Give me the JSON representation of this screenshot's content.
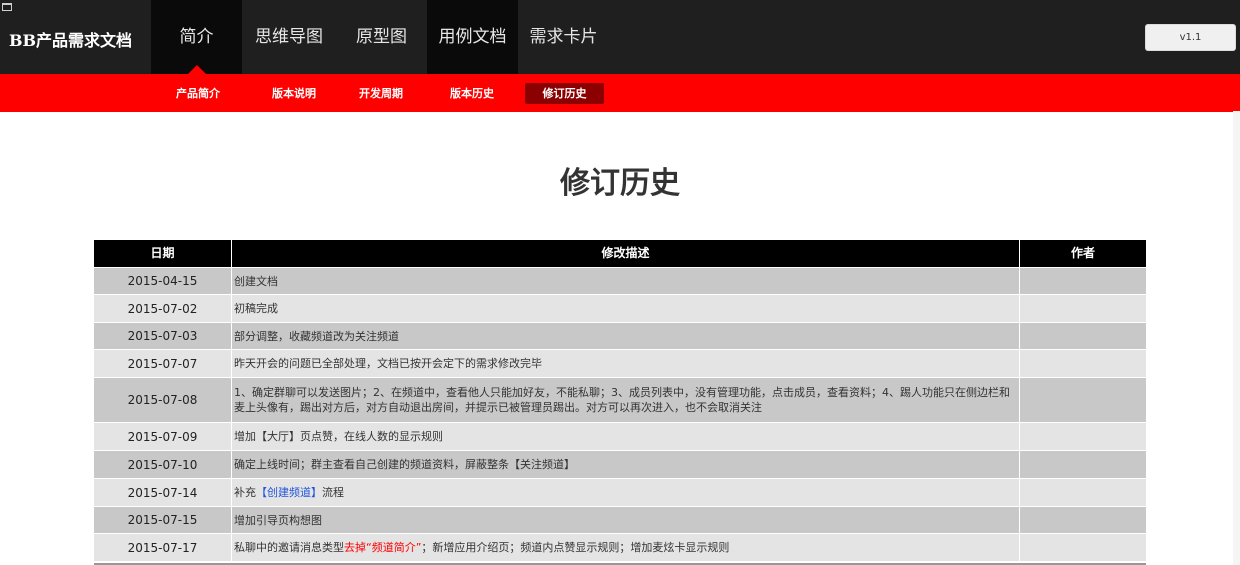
{
  "header": {
    "logo": "BB产品需求文档",
    "tabs": [
      {
        "label": "简介"
      },
      {
        "label": "思维导图"
      },
      {
        "label": "原型图"
      },
      {
        "label": "用例文档"
      },
      {
        "label": "需求卡片"
      }
    ],
    "version": "v1.1"
  },
  "subnav": {
    "items": [
      {
        "label": "产品简介"
      },
      {
        "label": "版本说明"
      },
      {
        "label": "开发周期"
      },
      {
        "label": "版本历史"
      },
      {
        "label": "修订历史"
      }
    ]
  },
  "page": {
    "title": "修订历史"
  },
  "table": {
    "headers": {
      "date": "日期",
      "desc": "修改描述",
      "author": "作者"
    },
    "rows": [
      {
        "date": "2015-04-15",
        "desc": "创建文档",
        "author": ""
      },
      {
        "date": "2015-07-02",
        "desc": "初稿完成",
        "author": ""
      },
      {
        "date": "2015-07-03",
        "desc": "部分调整，收藏频道改为关注频道",
        "author": ""
      },
      {
        "date": "2015-07-07",
        "desc": "昨天开会的问题已全部处理，文档已按开会定下的需求修改完毕",
        "author": ""
      },
      {
        "date": "2015-07-08",
        "desc": "1、确定群聊可以发送图片；2、在频道中，查看他人只能加好友，不能私聊；3、成员列表中，没有管理功能，点击成员，查看资料；4、踢人功能只在侧边栏和麦上头像有，踢出对方后，对方自动退出房间，并提示已被管理员踢出。对方可以再次进入，也不会取消关注",
        "author": ""
      },
      {
        "date": "2015-07-09",
        "desc": "增加【大厅】页点赞，在线人数的显示规则",
        "author": ""
      },
      {
        "date": "2015-07-10",
        "desc": "确定上线时间；群主查看自己创建的频道资料，屏蔽整条【关注频道】",
        "author": ""
      },
      {
        "date": "2015-07-14",
        "desc_pre": "补充",
        "desc_hl": "【创建频道】",
        "desc_post": "流程",
        "author": ""
      },
      {
        "date": "2015-07-15",
        "desc": "增加引导页构想图",
        "author": ""
      },
      {
        "date": "2015-07-17",
        "desc_pre": "私聊中的邀请消息类型",
        "desc_hl": "去掉“频道简介”",
        "desc_post": "；新增应用介绍页；频道内点赞显示规则；增加麦炫卡显示规则",
        "author": ""
      }
    ]
  }
}
